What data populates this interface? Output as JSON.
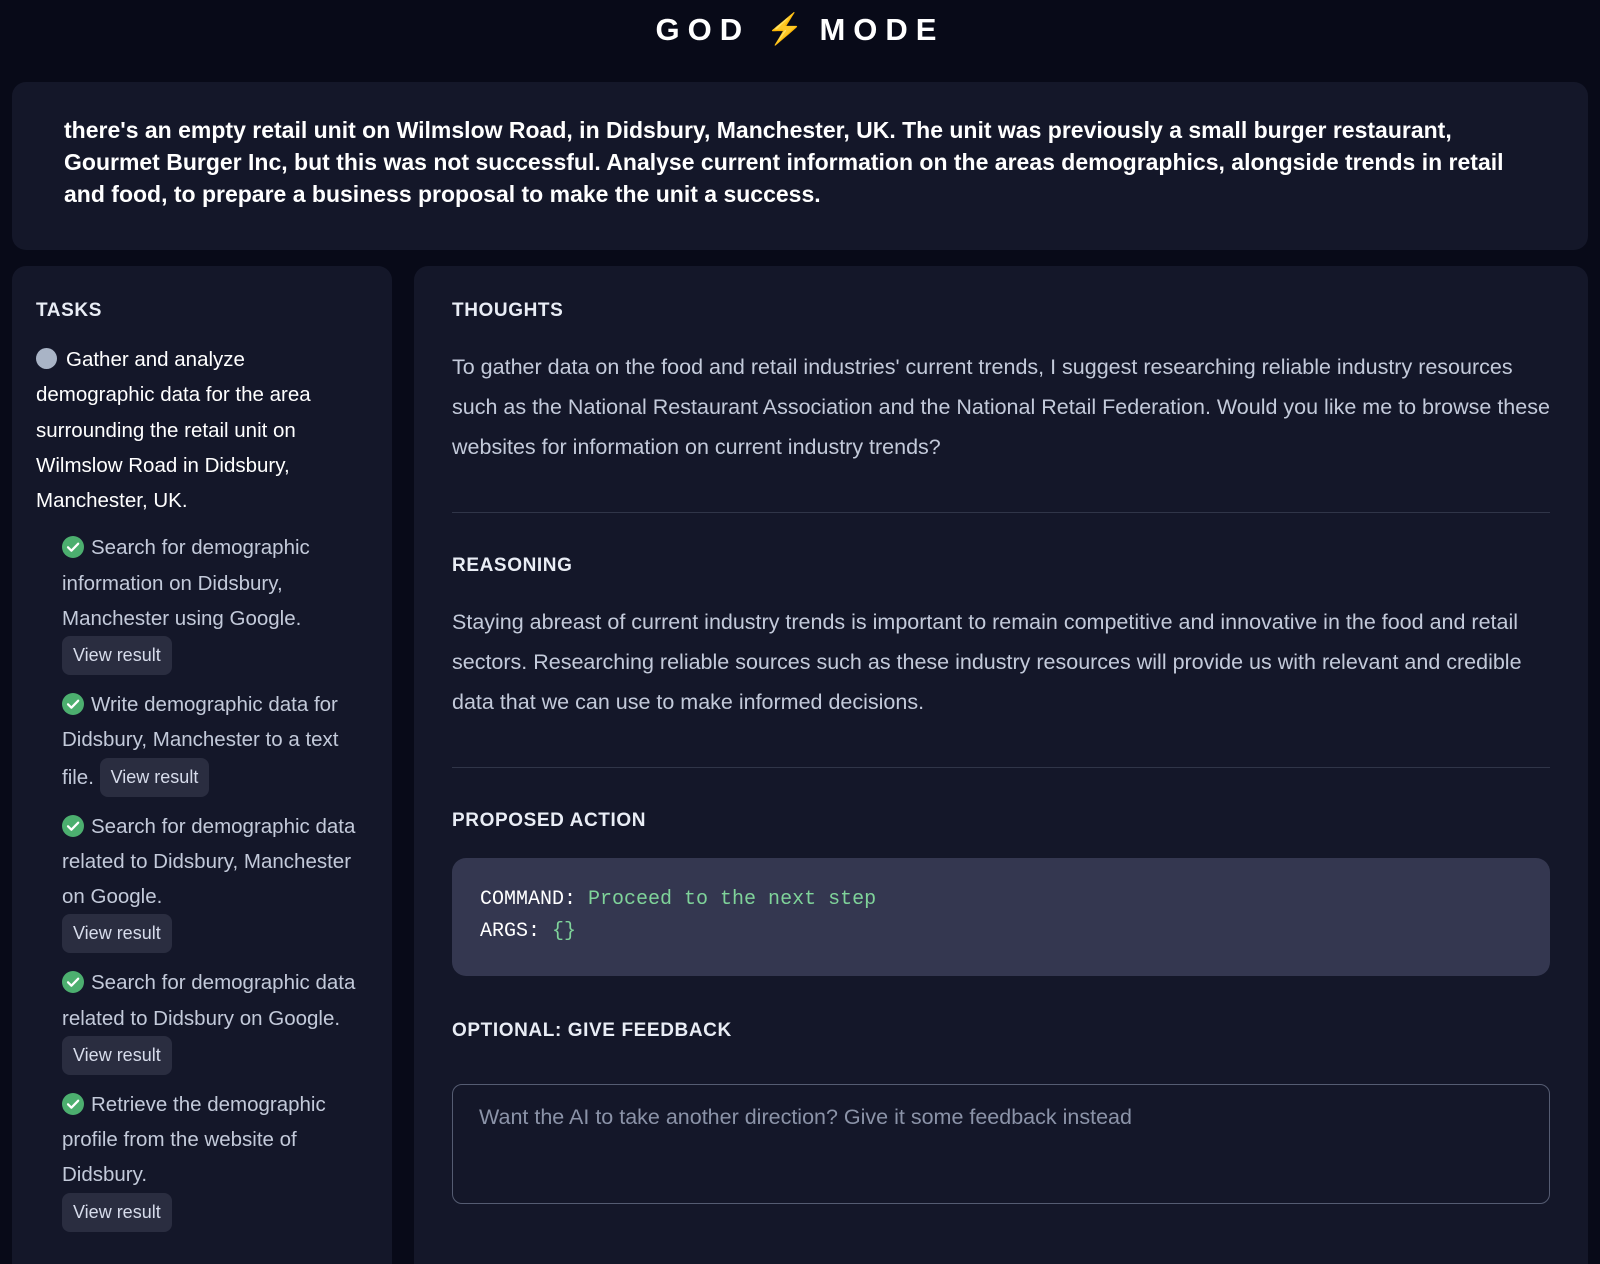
{
  "header": {
    "title_left": "GOD",
    "title_right": "MODE",
    "bolt_icon": "lightning-bolt-icon",
    "bolt_glyph": "⚡"
  },
  "prompt": {
    "text": "there's an empty retail unit on Wilmslow Road, in Didsbury, Manchester, UK. The unit was previously a small burger restaurant, Gourmet Burger Inc, but this was not successful. Analyse current information on the areas demographics, alongside trends in retail and food, to prepare a business proposal to make the unit a success."
  },
  "tasks": {
    "label": "TASKS",
    "main_task": {
      "status": "pending",
      "text": "Gather and analyze demographic data for the area surrounding the retail unit on Wilmslow Road in Didsbury, Manchester, UK."
    },
    "subtasks": [
      {
        "status": "done",
        "text": "Search for demographic information on Didsbury, Manchester using Google.",
        "button_label": "View result",
        "button_inline": false
      },
      {
        "status": "done",
        "text": "Write demographic data for Didsbury, Manchester to a text file.",
        "button_label": "View result",
        "button_inline": true
      },
      {
        "status": "done",
        "text": "Search for demographic data related to Didsbury, Manchester on Google.",
        "button_label": "View result",
        "button_inline": false
      },
      {
        "status": "done",
        "text": "Search for demographic data related to Didsbury on Google.",
        "button_label": "View result",
        "button_inline": true
      },
      {
        "status": "done",
        "text": "Retrieve the demographic profile from the website of Didsbury.",
        "button_label": "View result",
        "button_inline": false
      }
    ]
  },
  "main": {
    "thoughts": {
      "label": "THOUGHTS",
      "text": "To gather data on the food and retail industries' current trends, I suggest researching reliable industry resources such as the National Restaurant Association and the National Retail Federation. Would you like me to browse these websites for information on current industry trends?"
    },
    "reasoning": {
      "label": "REASONING",
      "text": "Staying abreast of current industry trends is important to remain competitive and innovative in the food and retail sectors. Researching reliable sources such as these industry resources will provide us with relevant and credible data that we can use to make informed decisions."
    },
    "proposed_action": {
      "label": "PROPOSED ACTION",
      "command_key": "COMMAND:",
      "command_value": "Proceed to the next step",
      "args_key": "ARGS:",
      "args_value": "{}"
    },
    "feedback": {
      "label": "OPTIONAL: GIVE FEEDBACK",
      "placeholder": "Want the AI to take another direction? Give it some feedback instead",
      "value": ""
    }
  },
  "colors": {
    "page_background": "#080a18",
    "panel_background": "#141729",
    "command_background": "#343750",
    "accent_green": "#4caf6f",
    "command_value_green": "#7fd39a",
    "bolt_orange": "#f5a623",
    "body_text": "#c3cada"
  }
}
